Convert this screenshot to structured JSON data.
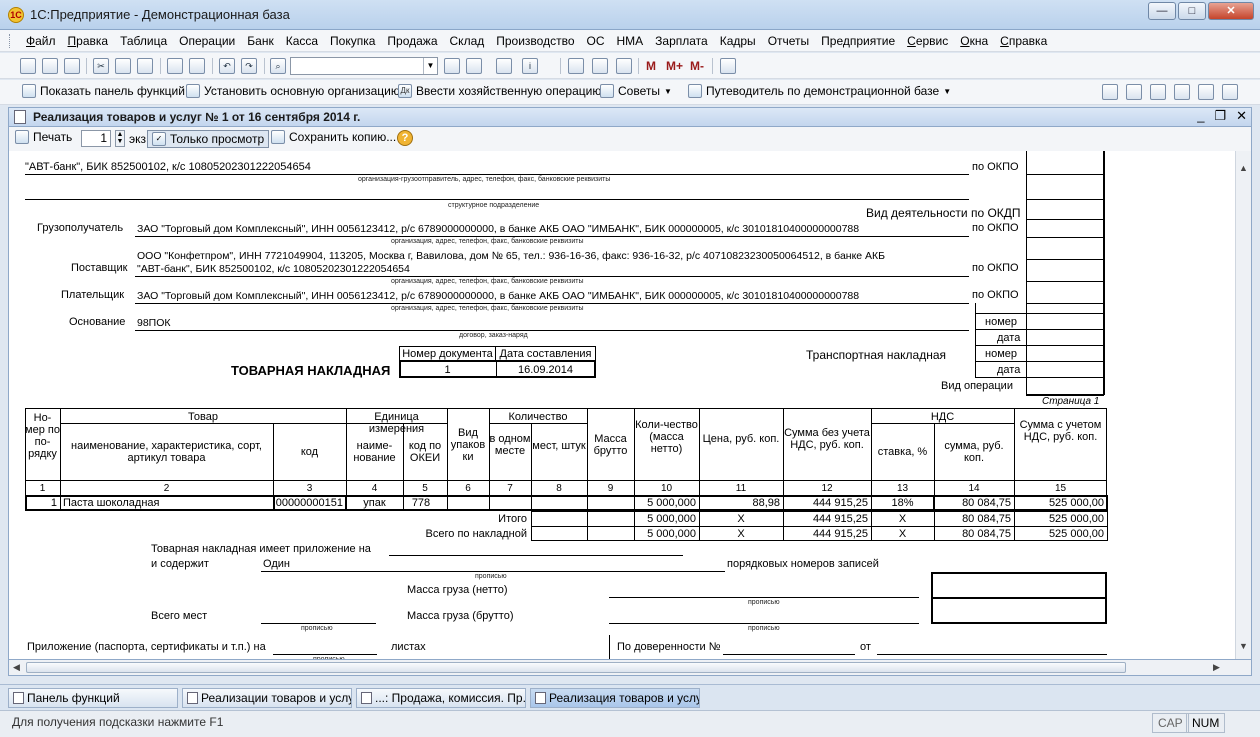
{
  "app": {
    "title": "1С:Предприятие - Демонстрационная база"
  },
  "menu": [
    "Файл",
    "Правка",
    "Таблица",
    "Операции",
    "Банк",
    "Касса",
    "Покупка",
    "Продажа",
    "Склад",
    "Производство",
    "ОС",
    "НМА",
    "Зарплата",
    "Кадры",
    "Отчеты",
    "Предприятие",
    "Сервис",
    "Окна",
    "Справка"
  ],
  "panel": {
    "show_functions": "Показать панель функций",
    "set_org": "Установить основную организацию",
    "enter_op": "Ввести хозяйственную операцию",
    "tips": "Советы",
    "guide": "Путеводитель по демонстрационной базе"
  },
  "doc": {
    "title": "Реализация товаров и услуг № 1 от 16 сентября 2014 г.",
    "print": "Печать",
    "copies": "1",
    "copies_unit": "экз.",
    "view_only": "Только просмотр",
    "save_copy": "Сохранить копию..."
  },
  "form": {
    "top_bank": "\"АВТ-банк\", БИК 852500102, к/с 10805202301222054654",
    "cap_org_full": "организация-грузоотправитель, адрес, телефон, факс, банковские реквизиты",
    "cap_division": "структурное подразделение",
    "okdp": "Вид деятельности по ОКДП",
    "okpo": "по ОКПО",
    "consignee_label": "Грузополучатель",
    "consignee": "ЗАО \"Торговый дом Комплексный\", ИНН 0056123412, р/с 6789000000000, в банке АКБ ОАО \"ИМБАНК\", БИК 000000005, к/с 30101810400000000788",
    "cap_org": "организация, адрес, телефон, факс, банковские реквизиты",
    "supplier_label": "Поставщик",
    "supplier_1": "ООО \"Конфетпром\", ИНН 7721049904, 113205, Москва г, Вавилова, дом № 65, тел.: 936-16-36, факс: 936-16-32, р/с 40710823230050064512, в банке АКБ",
    "supplier_2": "\"АВТ-банк\", БИК 852500102, к/с 10805202301222054654",
    "payer_label": "Плательщик",
    "payer": "ЗАО \"Торговый дом Комплексный\", ИНН 0056123412, р/с 6789000000000, в банке АКБ ОАО \"ИМБАНК\", БИК 000000005, к/с 30101810400000000788",
    "basis_label": "Основание",
    "basis": "98ПОК",
    "cap_contract": "договор, заказ-наряд",
    "number": "номер",
    "date": "дата",
    "transport": "Транспортная накладная",
    "op_type": "Вид операции",
    "doc_name": "ТОВАРНАЯ НАКЛАДНАЯ",
    "doc_num_h": "Номер документа",
    "doc_date_h": "Дата составления",
    "doc_num": "1",
    "doc_date": "16.09.2014",
    "page": "Страница 1"
  },
  "table": {
    "h_num": "Но-мер по по-рядку",
    "h_goods": "Товар",
    "h_goods_name": "наименование, характеристика, сорт, артикул товара",
    "h_code": "код",
    "h_unit": "Единица измерения",
    "h_unit_name": "наиме-нование",
    "h_okei": "код по ОКЕИ",
    "h_pack": "Вид упаков ки",
    "h_qty": "Количество",
    "h_one": "в одном месте",
    "h_places": "мест, штук",
    "h_gross": "Масса брутто",
    "h_qty_net": "Коли-чество (масса нетто)",
    "h_price": "Цена, руб. коп.",
    "h_sum_novat": "Сумма без учета НДС, руб. коп.",
    "h_vat": "НДС",
    "h_rate": "ставка, %",
    "h_vat_sum": "сумма, руб. коп.",
    "h_sum_vat": "Сумма с учетом НДС, руб. коп.",
    "col_nums": [
      "1",
      "2",
      "3",
      "4",
      "5",
      "6",
      "7",
      "8",
      "9",
      "10",
      "11",
      "12",
      "13",
      "14",
      "15"
    ],
    "row": {
      "n": "1",
      "name": "Паста шоколадная",
      "code": "00000000151",
      "unit": "упак",
      "okei": "778",
      "qty": "5 000,000",
      "price": "88,98",
      "sum": "444 915,25",
      "rate": "18%",
      "vat": "80 084,75",
      "total": "525 000,00"
    },
    "itogo_label": "Итого",
    "itogo": {
      "qty": "5 000,000",
      "price": "X",
      "sum": "444 915,25",
      "rate": "X",
      "vat": "80 084,75",
      "total": "525 000,00"
    },
    "vsego_label": "Всего по накладной",
    "vsego": {
      "qty": "5 000,000",
      "price": "X",
      "sum": "444 915,25",
      "rate": "X",
      "vat": "80 084,75",
      "total": "525 000,00"
    }
  },
  "bottom": {
    "attach": "Товарная накладная имеет приложение на",
    "contains": "и содержит",
    "contains_val": "Один",
    "records": "порядковых номеров записей",
    "propis": "прописью",
    "net": "Масса груза (нетто)",
    "gross": "Масса груза (брутто)",
    "places": "Всего мест",
    "docs": "Приложение (паспорта, сертификаты и т.п.) на",
    "sheets": "листах",
    "proxy": "По доверенности №",
    "from": "от"
  },
  "tasks": [
    "Панель функций",
    "Реализации товаров и услуг",
    "...: Продажа, комиссия. Пр...",
    "Реализация товаров и услу..."
  ],
  "status": {
    "hint": "Для получения подсказки нажмите F1",
    "cap": "CAP",
    "num": "NUM"
  }
}
